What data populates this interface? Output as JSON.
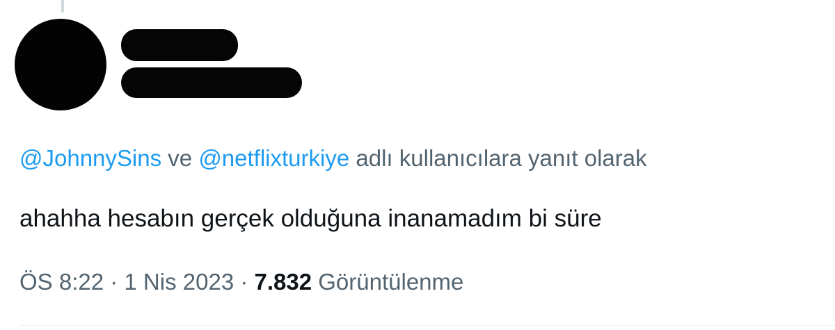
{
  "reply_context": {
    "mention_1": "@JohnnySins",
    "connector": " ve ",
    "mention_2": "@netflixturkiye",
    "suffix": " adlı kullanıcılara yanıt olarak"
  },
  "tweet": {
    "text": "ahahha hesabın gerçek olduğuna inanamadım bi süre"
  },
  "meta": {
    "time": "ÖS 8:22",
    "separator_1": " · ",
    "date": "1 Nis 2023",
    "separator_2": " · ",
    "views_count": "7.832",
    "views_label": " Görüntülenme"
  },
  "colors": {
    "link": "#1d9bf0",
    "secondary_text": "#536471",
    "primary_text": "#0f1419",
    "redaction": "#050505"
  }
}
